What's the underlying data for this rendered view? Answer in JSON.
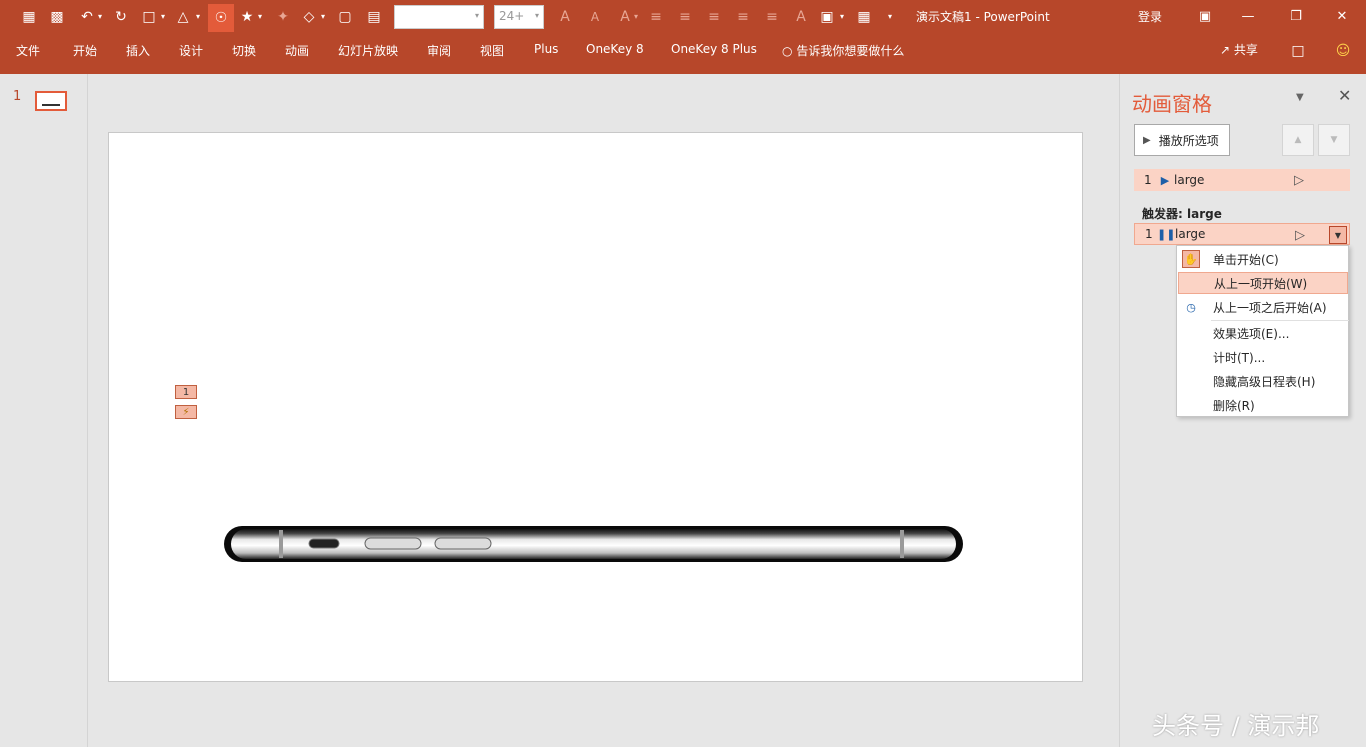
{
  "titlebar": {
    "doc_title": "演示文稿1  -  PowerPoint",
    "login": "登录",
    "font_size": "24+",
    "font_name": "",
    "icons": [
      "save-icon",
      "save-as-icon",
      "undo-icon",
      "redo-icon",
      "format-painter-icon",
      "shape-icon",
      "trigger-icon",
      "animation-effect-icon",
      "brush-icon",
      "eraser-icon",
      "new-slide-icon",
      "layout-icon",
      "grow-font-icon",
      "shrink-font-icon",
      "font-color-icon",
      "align-left-icon",
      "align-center-icon",
      "align-right-icon",
      "justify-icon",
      "indent-icon",
      "text-direction-icon",
      "textbox-icon",
      "arrange-icon",
      "customize-qat-icon"
    ]
  },
  "ribbon": {
    "tabs": [
      "文件",
      "开始",
      "插入",
      "设计",
      "切换",
      "动画",
      "幻灯片放映",
      "审阅",
      "视图",
      "Plus",
      "OneKey 8",
      "OneKey 8 Plus"
    ],
    "tell_me": "告诉我你想要做什么",
    "share": "共享"
  },
  "thumbnails": {
    "slide_number": "1"
  },
  "slide": {
    "tag_number": "1",
    "tag_trigger": "⚡"
  },
  "animation_pane": {
    "title": "动画窗格",
    "play_button": "播放所选项",
    "rows": [
      {
        "number": "1",
        "name": "large"
      }
    ],
    "trigger_label": "触发器: large",
    "trigger_rows": [
      {
        "number": "1",
        "name": "large"
      }
    ]
  },
  "context_menu": {
    "items": [
      {
        "label": "单击开始(C)",
        "icon": "mouse-click-icon"
      },
      {
        "label": "从上一项开始(W)",
        "icon": "",
        "hover": true
      },
      {
        "label": "从上一项之后开始(A)",
        "icon": "clock-icon"
      },
      {
        "label": "效果选项(E)..."
      },
      {
        "label": "计时(T)..."
      },
      {
        "label": "隐藏高级日程表(H)"
      },
      {
        "label": "删除(R)"
      }
    ]
  },
  "watermark": "头条号 / 演示邦",
  "colors": {
    "accent": "#b7472a",
    "accent_light": "#fbd3c5",
    "pane_title": "#e35b3a"
  }
}
